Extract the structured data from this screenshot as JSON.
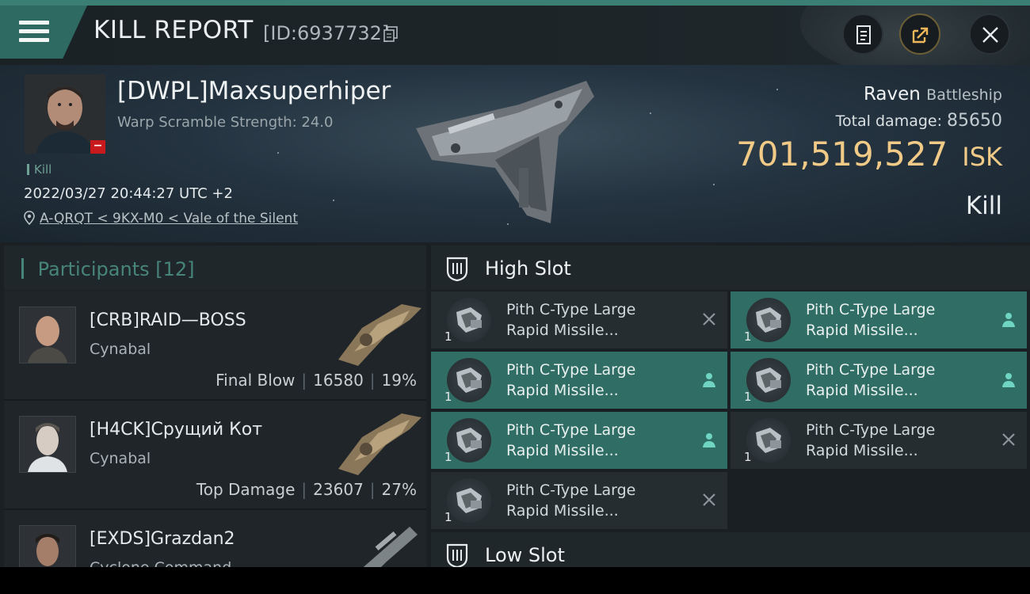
{
  "header": {
    "title": "KILL REPORT",
    "report_id": "[ID:6937732]",
    "icons": [
      "menu-icon",
      "copy-icon",
      "notes-icon",
      "share-icon",
      "close-icon"
    ]
  },
  "victim": {
    "name": "[DWPL]Maxsuperhiper",
    "scramble": "Warp Scramble Strength: 24.0",
    "badge": "−",
    "kill_tag": "Kill",
    "datetime": "2022/03/27 20:44:27 UTC +2",
    "location": "A-QRQT < 9KX-M0 < Vale of the Silent",
    "ship": "Raven",
    "ship_class": "Battleship",
    "total_damage_label": "Total damage:",
    "total_damage": "85650",
    "isk_value": "701,519,527",
    "isk_unit": "ISK",
    "result": "Kill"
  },
  "participants": {
    "title": "Participants",
    "count": "[12]",
    "items": [
      {
        "name": "[CRB]RAID—BOSS",
        "ship": "Cynabal",
        "role": "Final Blow",
        "damage": "16580",
        "percent": "19%"
      },
      {
        "name": "[H4CK]Срущий Кот",
        "ship": "Cynabal",
        "role": "Top Damage",
        "damage": "23607",
        "percent": "27%"
      },
      {
        "name": "[EXDS]Grazdan2",
        "ship": "Cyclone Command",
        "role": "",
        "damage": "",
        "percent": ""
      }
    ]
  },
  "slots": {
    "high_label": "High Slot",
    "low_label": "Low Slot",
    "high_modules": [
      {
        "line1": "Pith C-Type Large",
        "line2": "Rapid Missile...",
        "qty": "1",
        "status": "destroyed",
        "status_icon": "close-icon"
      },
      {
        "line1": "Pith C-Type Large",
        "line2": "Rapid Missile...",
        "qty": "1",
        "status": "dropped",
        "status_icon": "person-icon"
      },
      {
        "line1": "Pith C-Type Large",
        "line2": "Rapid Missile...",
        "qty": "1",
        "status": "dropped",
        "status_icon": "person-icon"
      },
      {
        "line1": "Pith C-Type Large",
        "line2": "Rapid Missile...",
        "qty": "1",
        "status": "dropped",
        "status_icon": "person-icon"
      },
      {
        "line1": "Pith C-Type Large",
        "line2": "Rapid Missile...",
        "qty": "1",
        "status": "dropped",
        "status_icon": "person-icon"
      },
      {
        "line1": "Pith C-Type Large",
        "line2": "Rapid Missile...",
        "qty": "1",
        "status": "destroyed",
        "status_icon": "close-icon"
      },
      {
        "line1": "Pith C-Type Large",
        "line2": "Rapid Missile...",
        "qty": "1",
        "status": "destroyed",
        "status_icon": "close-icon"
      }
    ]
  },
  "colors": {
    "accent": "#2f6d65",
    "isk": "#f0ca86",
    "teal_text": "#47857a",
    "badge_red": "#c8191d"
  }
}
